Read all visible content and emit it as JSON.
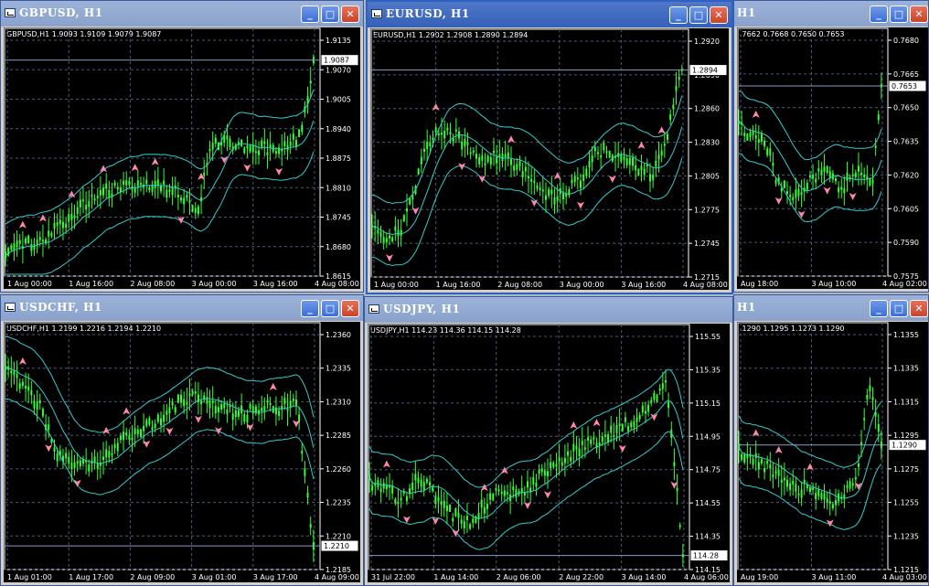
{
  "windows": [
    {
      "id": "gbpusd",
      "title": "GBPUSD, H1",
      "active": false,
      "info": "GBPUSD,H1  1.9093 1.9109 1.9079 1.9087",
      "price_labels": [
        "1.9135",
        "1.9070",
        "1.9005",
        "1.8940",
        "1.8875",
        "1.8810",
        "1.8745",
        "1.8680",
        "1.8615"
      ],
      "current_price": "1.9087",
      "time_labels": [
        "1 Aug 00:00",
        "1 Aug 16:00",
        "2 Aug 08:00",
        "3 Aug 00:00",
        "3 Aug 16:00",
        "4 Aug 08:00"
      ]
    },
    {
      "id": "eurusd",
      "title": "EURUSD, H1",
      "active": true,
      "info": "EURUSD,H1  1.2902 1.2908 1.2890 1.2894",
      "price_labels": [
        "1.2920",
        "1.2890",
        "1.2860",
        "1.2830",
        "1.2805",
        "1.2775",
        "1.2745",
        "1.2715"
      ],
      "current_price": "1.2894",
      "time_labels": [
        "1 Aug 00:00",
        "1 Aug 16:00",
        "2 Aug 08:00",
        "3 Aug 00:00",
        "3 Aug 16:00",
        "4 Aug 08:00"
      ]
    },
    {
      "id": "win3",
      "title": "H1",
      "active": false,
      "info": ".7662 0.7668 0.7650 0.7653",
      "price_labels": [
        "0.7680",
        "0.7665",
        "0.7650",
        "0.7635",
        "0.7620",
        "0.7605",
        "0.7590",
        "0.7575"
      ],
      "current_price": "0.7653",
      "time_labels": [
        "Aug 18:00",
        "3 Aug 10:00",
        "4 Aug 02:00"
      ]
    },
    {
      "id": "usdchf",
      "title": "USDCHF, H1",
      "active": false,
      "info": "USDCHF,H1  1.2199 1.2216 1.2194 1.2210",
      "price_labels": [
        "1.2360",
        "1.2335",
        "1.2310",
        "1.2285",
        "1.2260",
        "1.2235",
        "1.2210",
        "1.2185"
      ],
      "current_price": "1.2210",
      "time_labels": [
        "1 Aug 01:00",
        "1 Aug 17:00",
        "2 Aug 09:00",
        "3 Aug 01:00",
        "3 Aug 17:00",
        "4 Aug 09:00"
      ]
    },
    {
      "id": "usdjpy",
      "title": "USDJPY, H1",
      "active": false,
      "info": "USDJPY,H1  114.23 114.36 114.15 114.28",
      "price_labels": [
        "115.55",
        "115.35",
        "115.15",
        "114.95",
        "114.75",
        "114.55",
        "114.35",
        "114.15"
      ],
      "current_price": "114.28",
      "time_labels": [
        "31 Jul 22:00",
        "1 Aug 14:00",
        "2 Aug 06:00",
        "2 Aug 22:00",
        "3 Aug 14:00",
        "4 Aug 06:00"
      ]
    },
    {
      "id": "win6",
      "title": "H1",
      "active": false,
      "info": ".1290 1.1295 1.1273 1.1290",
      "price_labels": [
        "1.1355",
        "1.1335",
        "1.1315",
        "1.1295",
        "1.1275",
        "1.1255",
        "1.1235",
        "1.1215"
      ],
      "current_price": "1.1290",
      "time_labels": [
        "Aug 19:00",
        "3 Aug 11:00",
        "4 Aug 03:00"
      ]
    }
  ],
  "colors": {
    "background": "#000000",
    "grid": "#4a5a78",
    "candles": "#33ff33",
    "bands": "#33cccc",
    "arrows": "#ff88aa",
    "axis_text": "#ffffff",
    "frame": "#ffffff"
  }
}
